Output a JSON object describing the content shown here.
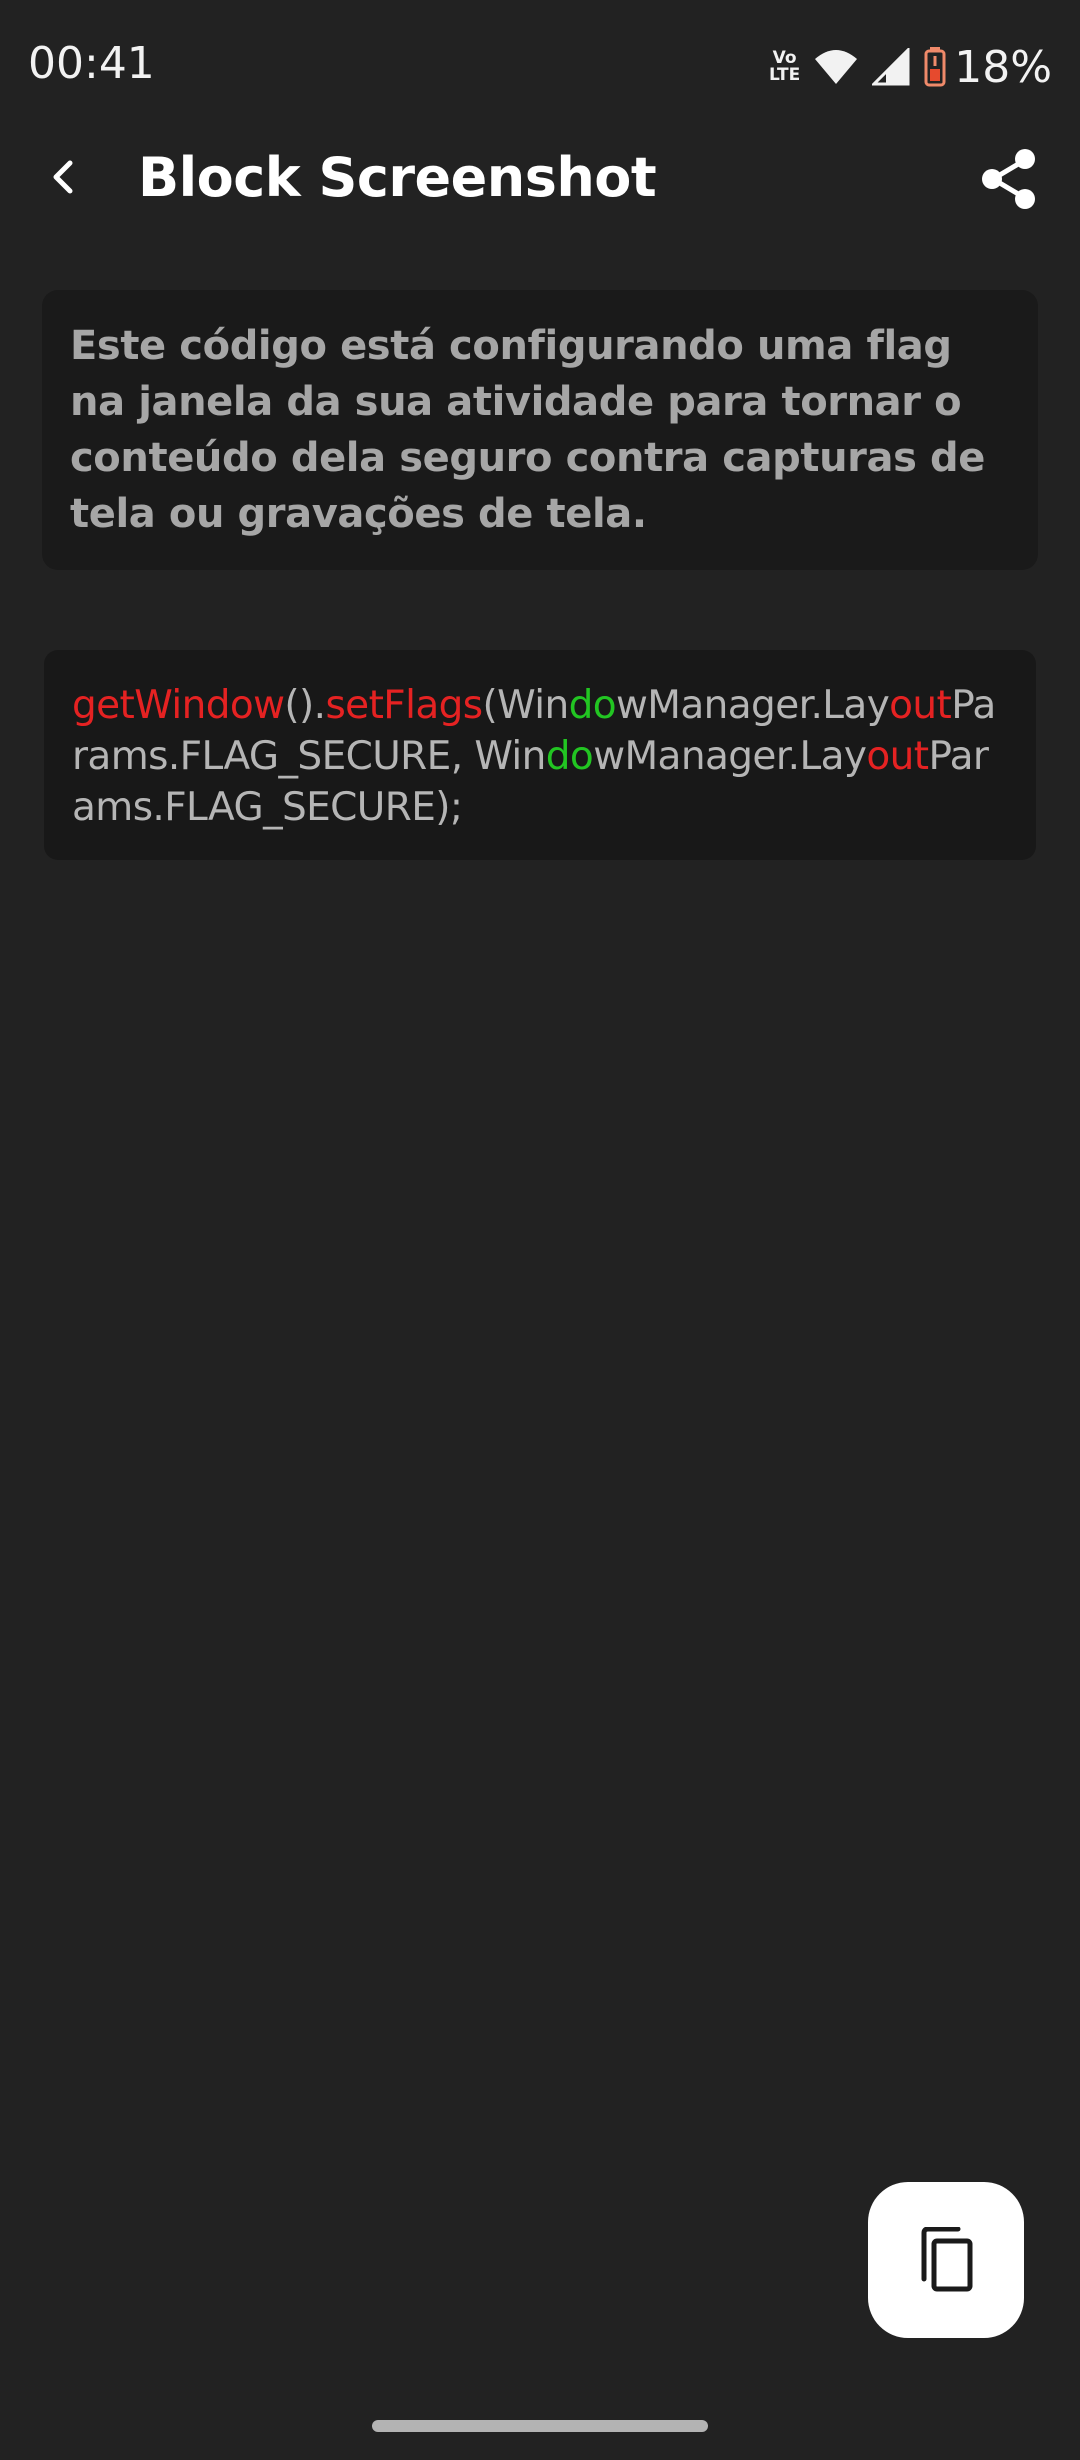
{
  "status_bar": {
    "time": "00:41",
    "volte_top": "Vo",
    "volte_bottom": "LTE",
    "battery_percent": "18%",
    "icons": [
      "volte-icon",
      "wifi-icon",
      "signal-icon",
      "battery-icon"
    ]
  },
  "app_bar": {
    "title": "Block Screenshot",
    "back_icon": "back-arrow-icon",
    "share_icon": "share-icon"
  },
  "description": {
    "text": "Este código está configurando uma flag na janela da sua atividade para tornar o conteúdo dela seguro contra capturas de tela ou gravações de tela."
  },
  "code": {
    "tokens": [
      {
        "text": "getWindow",
        "style": "red"
      },
      {
        "text": "().",
        "style": "plain"
      },
      {
        "text": "setFlags",
        "style": "red"
      },
      {
        "text": "(Win",
        "style": "plain"
      },
      {
        "text": "do",
        "style": "green"
      },
      {
        "text": "wManager.Lay",
        "style": "plain"
      },
      {
        "text": "out",
        "style": "red"
      },
      {
        "text": "Params.FLAG_SECURE, Win",
        "style": "plain"
      },
      {
        "text": "do",
        "style": "green"
      },
      {
        "text": "wManager.Lay",
        "style": "plain"
      },
      {
        "text": "out",
        "style": "red"
      },
      {
        "text": "Params.FLAG_SECURE);",
        "style": "plain"
      }
    ]
  },
  "fab": {
    "icon": "copy-icon"
  },
  "colors": {
    "background": "#222222",
    "card": "#1a1a1a",
    "code_card": "#181818",
    "keyword_red": "#e52222",
    "keyword_green": "#22c522",
    "fab_bg": "#ffffff"
  }
}
